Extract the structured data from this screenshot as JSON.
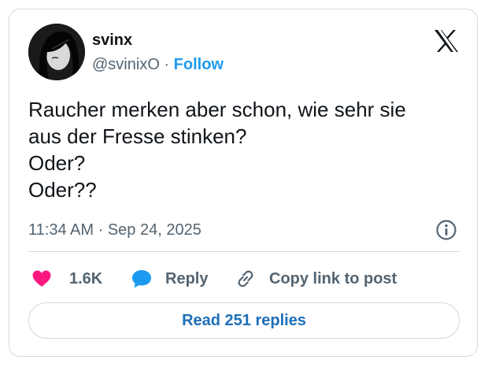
{
  "author": {
    "name": "svinx",
    "handle": "@svinixO",
    "separator": "·",
    "follow_label": "Follow"
  },
  "post": {
    "lines": [
      "Raucher merken aber schon, wie sehr sie",
      "aus der Fresse stinken?",
      "Oder?",
      "Oder??"
    ],
    "time": "11:34 AM",
    "separator": "·",
    "date": "Sep 24, 2025"
  },
  "actions": {
    "like_count": "1.6K",
    "reply_label": "Reply",
    "copy_label": "Copy link to post"
  },
  "read_replies_label": "Read 251 replies",
  "colors": {
    "accent": "#1d9bf0",
    "like": "#f91880",
    "border": "#cfd9de",
    "muted": "#536471"
  },
  "icons": [
    "avatar",
    "x-logo-icon",
    "info-icon",
    "heart-icon",
    "speech-bubble-icon",
    "link-icon"
  ]
}
